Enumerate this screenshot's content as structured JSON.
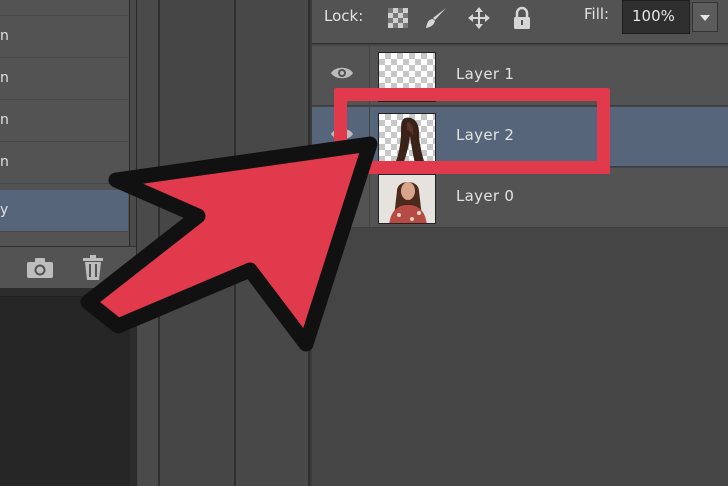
{
  "colors": {
    "panel": "#535353",
    "selected": "#56657a",
    "annotation_red": "#e03a4c",
    "annotation_outline": "#111111"
  },
  "history": {
    "items": [
      {
        "label": "n"
      },
      {
        "label": "n"
      },
      {
        "label": "n"
      },
      {
        "label": "n"
      },
      {
        "label": "y"
      }
    ],
    "selected_index": 4,
    "footer_icons": [
      "camera-icon",
      "trash-icon"
    ]
  },
  "layers_panel": {
    "lock_label": "Lock:",
    "lock_icons": [
      "lock-transparent-pixels-icon",
      "lock-image-pixels-icon",
      "lock-position-icon",
      "lock-all-icon"
    ],
    "fill_label": "Fill:",
    "fill_value": "100%",
    "layers": [
      {
        "name": "Layer 1",
        "visible": true,
        "thumbnail": "transparent"
      },
      {
        "name": "Layer 2",
        "visible": true,
        "thumbnail": "hair-cutout",
        "selected": true
      },
      {
        "name": "Layer 0",
        "visible": true,
        "thumbnail": "photo"
      }
    ]
  },
  "annotation": {
    "highlighted_layer": "Layer 2",
    "pointer_icon": "red-arrow-icon"
  }
}
